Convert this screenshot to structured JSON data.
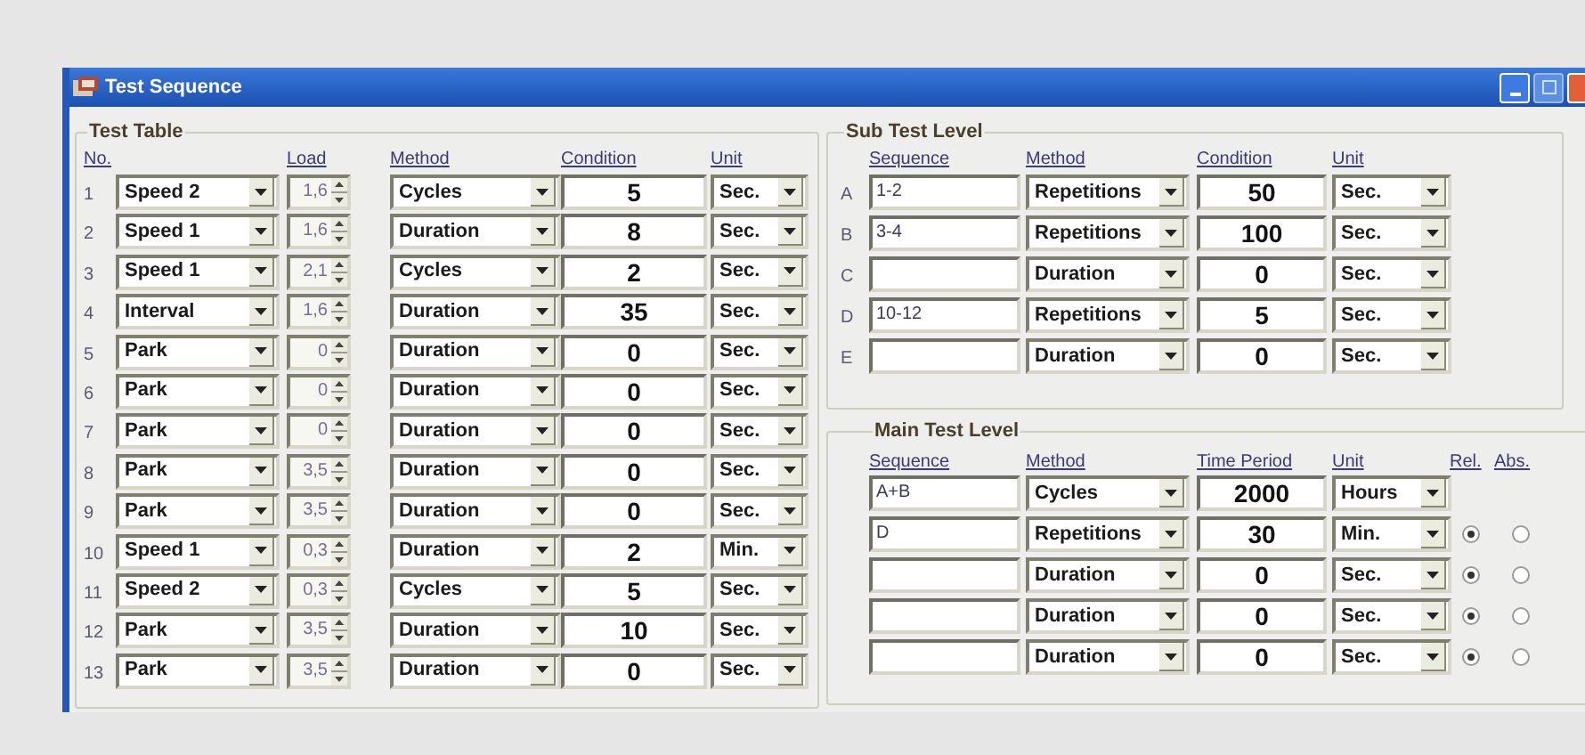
{
  "window": {
    "title": "Test Sequence"
  },
  "test_table": {
    "title": "Test Table",
    "columns": [
      "No.",
      "Load",
      "Method",
      "Condition",
      "Unit"
    ],
    "rows": [
      {
        "no": "1",
        "step": "Speed 2",
        "load": "1,6",
        "method": "Cycles",
        "condition": "5",
        "unit": "Sec."
      },
      {
        "no": "2",
        "step": "Speed 1",
        "load": "1,6",
        "method": "Duration",
        "condition": "8",
        "unit": "Sec."
      },
      {
        "no": "3",
        "step": "Speed 1",
        "load": "2,1",
        "method": "Cycles",
        "condition": "2",
        "unit": "Sec."
      },
      {
        "no": "4",
        "step": "Interval",
        "load": "1,6",
        "method": "Duration",
        "condition": "35",
        "unit": "Sec."
      },
      {
        "no": "5",
        "step": "Park",
        "load": "0",
        "method": "Duration",
        "condition": "0",
        "unit": "Sec."
      },
      {
        "no": "6",
        "step": "Park",
        "load": "0",
        "method": "Duration",
        "condition": "0",
        "unit": "Sec."
      },
      {
        "no": "7",
        "step": "Park",
        "load": "0",
        "method": "Duration",
        "condition": "0",
        "unit": "Sec."
      },
      {
        "no": "8",
        "step": "Park",
        "load": "3,5",
        "method": "Duration",
        "condition": "0",
        "unit": "Sec."
      },
      {
        "no": "9",
        "step": "Park",
        "load": "3,5",
        "method": "Duration",
        "condition": "0",
        "unit": "Sec."
      },
      {
        "no": "10",
        "step": "Speed 1",
        "load": "0,3",
        "method": "Duration",
        "condition": "2",
        "unit": "Min."
      },
      {
        "no": "11",
        "step": "Speed 2",
        "load": "0,3",
        "method": "Cycles",
        "condition": "5",
        "unit": "Sec."
      },
      {
        "no": "12",
        "step": "Park",
        "load": "3,5",
        "method": "Duration",
        "condition": "10",
        "unit": "Sec."
      },
      {
        "no": "13",
        "step": "Park",
        "load": "3,5",
        "method": "Duration",
        "condition": "0",
        "unit": "Sec."
      }
    ]
  },
  "sub_test_level": {
    "title": "Sub Test Level",
    "columns": [
      "Sequence",
      "Method",
      "Condition",
      "Unit"
    ],
    "rows": [
      {
        "letter": "A",
        "sequence": "1-2",
        "method": "Repetitions",
        "condition": "50",
        "unit": "Sec."
      },
      {
        "letter": "B",
        "sequence": "3-4",
        "method": "Repetitions",
        "condition": "100",
        "unit": "Sec."
      },
      {
        "letter": "C",
        "method": "Duration",
        "condition": "0",
        "unit": "Sec."
      },
      {
        "letter": "D",
        "sequence": "10-12",
        "method": "Repetitions",
        "condition": "5",
        "unit": "Sec."
      },
      {
        "letter": "E",
        "method": "Duration",
        "condition": "0",
        "unit": "Sec."
      }
    ]
  },
  "main_test_level": {
    "title": "Main Test Level",
    "columns": [
      "Sequence",
      "Method",
      "Time Period",
      "Unit",
      "Rel.",
      "Abs."
    ],
    "rows": [
      {
        "sequence": "A+B",
        "method": "Cycles",
        "time_period": "2000",
        "unit": "Hours"
      },
      {
        "sequence": "D",
        "method": "Repetitions",
        "time_period": "30",
        "unit": "Min.",
        "rel_selected": true,
        "abs_selected": false
      },
      {
        "method": "Duration",
        "time_period": "0",
        "unit": "Sec.",
        "rel_selected": true,
        "abs_selected": false
      },
      {
        "method": "Duration",
        "time_period": "0",
        "unit": "Sec.",
        "rel_selected": true,
        "abs_selected": false
      },
      {
        "method": "Duration",
        "time_period": "0",
        "unit": "Sec.",
        "rel_selected": true,
        "abs_selected": false
      }
    ]
  }
}
